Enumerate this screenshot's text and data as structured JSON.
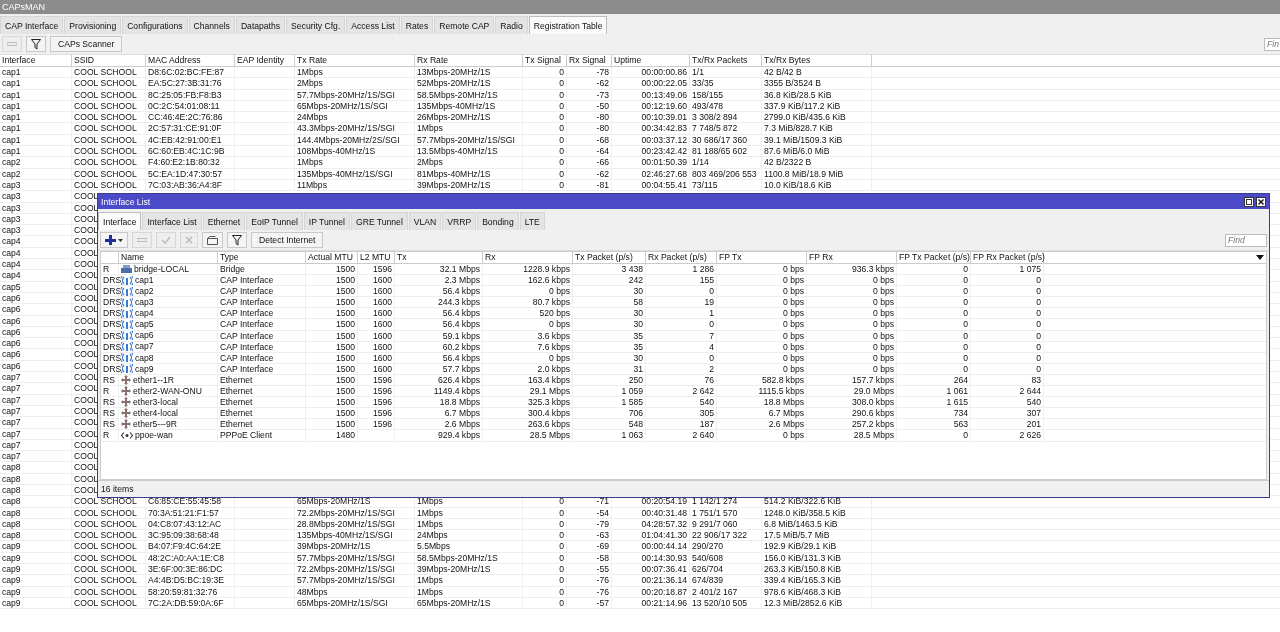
{
  "window": {
    "title": "CAPsMAN"
  },
  "tabs": [
    {
      "label": "CAP Interface",
      "selected": false
    },
    {
      "label": "Provisioning",
      "selected": false
    },
    {
      "label": "Configurations",
      "selected": false
    },
    {
      "label": "Channels",
      "selected": false
    },
    {
      "label": "Datapaths",
      "selected": false
    },
    {
      "label": "Security Cfg.",
      "selected": false
    },
    {
      "label": "Access List",
      "selected": false
    },
    {
      "label": "Rates",
      "selected": false
    },
    {
      "label": "Remote CAP",
      "selected": false
    },
    {
      "label": "Radio",
      "selected": false
    },
    {
      "label": "Registration Table",
      "selected": true
    }
  ],
  "toolbar": {
    "buttons": [
      {
        "kind": "remove",
        "disabled": true
      },
      {
        "kind": "filter",
        "disabled": false
      },
      {
        "kind": "text",
        "label": "CAPs Scanner",
        "disabled": false
      }
    ],
    "find": {
      "placeholder": "Fin"
    }
  },
  "table": {
    "columns": [
      "Interface",
      "SSID",
      "MAC Address",
      "EAP Identity",
      "Tx Rate",
      "Rx Rate",
      "Tx Signal",
      "Rx Signal",
      "Uptime",
      "Tx/Rx Packets",
      "Tx/Rx Bytes"
    ],
    "rows": [
      [
        "cap1",
        "COOL SCHOOL",
        "D8:6C:02:BC:FE:87",
        null,
        "1Mbps",
        "13Mbps-20MHz/1S",
        "0",
        "-78",
        "00:00:00.86",
        "1/1",
        "42 B/42 B"
      ],
      [
        "cap1",
        "COOL SCHOOL",
        "EA:5C:27:3B:31:76",
        null,
        "2Mbps",
        "52Mbps-20MHz/1S",
        "0",
        "-62",
        "00:00:22.05",
        "33/35",
        "3355 B/3524 B"
      ],
      [
        "cap1",
        "COOL SCHOOL",
        "8C:25:05:FB:F8:B3",
        null,
        "57.7Mbps-20MHz/1S/SGI",
        "58.5Mbps-20MHz/1S",
        "0",
        "-73",
        "00:13:49.06",
        "158/155",
        "36.8 KiB/28.5 KiB"
      ],
      [
        "cap1",
        "COOL SCHOOL",
        "0C:2C:54:01:08:11",
        null,
        "65Mbps-20MHz/1S/SGI",
        "135Mbps-40MHz/1S",
        "0",
        "-50",
        "00:12:19.60",
        "493/478",
        "337.9 KiB/117.2 KiB"
      ],
      [
        "cap1",
        "COOL SCHOOL",
        "CC:46:4E:2C:76:86",
        null,
        "24Mbps",
        "26Mbps-20MHz/1S",
        "0",
        "-80",
        "00:10:39.01",
        "3 308/2 894",
        "2799.0 KiB/435.6 KiB"
      ],
      [
        "cap1",
        "COOL SCHOOL",
        "2C:57:31:CE:91:0F",
        null,
        "43.3Mbps-20MHz/1S/SGI",
        "1Mbps",
        "0",
        "-80",
        "00:34:42.83",
        "7 748/5 872",
        "7.3 MiB/828.7 KiB"
      ],
      [
        "cap1",
        "COOL SCHOOL",
        "4C:EB:42:91:00:E1",
        null,
        "144.4Mbps-20MHz/2S/SGI",
        "57.7Mbps-20MHz/1S/SGI",
        "0",
        "-68",
        "00:03:37.12",
        "30 686/17 360",
        "39.1 MiB/1509.3 KiB"
      ],
      [
        "cap1",
        "COOL SCHOOL",
        "6C:60:EB:4C:1C:9B",
        null,
        "108Mbps-40MHz/1S",
        "13.5Mbps-40MHz/1S",
        "0",
        "-64",
        "00:23:42.42",
        "81 188/65 602",
        "87.6 MiB/6.0 MiB"
      ],
      [
        "cap2",
        "COOL SCHOOL",
        "F4:60:E2:1B:80:32",
        null,
        "1Mbps",
        "2Mbps",
        "0",
        "-66",
        "00:01:50.39",
        "1/14",
        "42 B/2322 B"
      ],
      [
        "cap2",
        "COOL SCHOOL",
        "5C:EA:1D:47:30:57",
        null,
        "135Mbps-40MHz/1S/SGI",
        "81Mbps-40MHz/1S",
        "0",
        "-62",
        "02:46:27.68",
        "803 469/206 553",
        "1100.8 MiB/18.9 MiB"
      ],
      [
        "cap3",
        "COOL SCHOOL",
        "7C:03:AB:36:A4:8F",
        null,
        "11Mbps",
        "39Mbps-20MHz/1S",
        "0",
        "-81",
        "00:04:55.41",
        "73/115",
        "10.0 KiB/18.6 KiB"
      ],
      [
        "cap3",
        "COOL"
      ],
      [
        "cap3",
        "COOL"
      ],
      [
        "cap3",
        "COOL"
      ],
      [
        "cap3",
        "COOL"
      ],
      [
        "cap4",
        "COOL"
      ],
      [
        "cap4",
        "COOL"
      ],
      [
        "cap4",
        "COOL"
      ],
      [
        "cap4",
        "COOL"
      ],
      [
        "cap5",
        "COOL"
      ],
      [
        "cap6",
        "COOL"
      ],
      [
        "cap6",
        "COOL"
      ],
      [
        "cap6",
        "COOL"
      ],
      [
        "cap6",
        "COOL"
      ],
      [
        "cap6",
        "COOL"
      ],
      [
        "cap6",
        "COOL"
      ],
      [
        "cap6",
        "COOL"
      ],
      [
        "cap7",
        "COOL"
      ],
      [
        "cap7",
        "COOL"
      ],
      [
        "cap7",
        "COOL"
      ],
      [
        "cap7",
        "COOL"
      ],
      [
        "cap7",
        "COOL"
      ],
      [
        "cap7",
        "COOL"
      ],
      [
        "cap7",
        "COOL"
      ],
      [
        "cap7",
        "COOL"
      ],
      [
        "cap8",
        "COOL"
      ],
      [
        "cap8",
        "COOL"
      ],
      [
        "cap8",
        "COOL"
      ],
      [
        "cap8",
        "COOL SCHOOL",
        "C6:85:CE:55:45:58",
        null,
        "65Mbps-20MHz/1S",
        "1Mbps",
        "0",
        "-71",
        "00:20:54.19",
        "1 142/1 274",
        "514.2 KiB/322.6 KiB"
      ],
      [
        "cap8",
        "COOL SCHOOL",
        "70:3A:51:21:F1:57",
        null,
        "72.2Mbps-20MHz/1S/SGI",
        "1Mbps",
        "0",
        "-54",
        "00:40:31.48",
        "1 751/1 570",
        "1248.0 KiB/358.5 KiB"
      ],
      [
        "cap8",
        "COOL SCHOOL",
        "04:C8:07:43:12:AC",
        null,
        "28.8Mbps-20MHz/1S/SGI",
        "1Mbps",
        "0",
        "-79",
        "04:28:57.32",
        "9 291/7 060",
        "6.8 MiB/1463.5 KiB"
      ],
      [
        "cap8",
        "COOL SCHOOL",
        "3C:95:09:38:68:48",
        null,
        "135Mbps-40MHz/1S/SGI",
        "24Mbps",
        "0",
        "-63",
        "01:04:41.30",
        "22 906/17 322",
        "17.5 MiB/5.7 MiB"
      ],
      [
        "cap9",
        "COOL SCHOOL",
        "B4:07:F9:4C:64:2E",
        null,
        "39Mbps-20MHz/1S",
        "5.5Mbps",
        "0",
        "-69",
        "00:00:44.14",
        "290/270",
        "192.9 KiB/29.1 KiB"
      ],
      [
        "cap9",
        "COOL SCHOOL",
        "48:2C:A0:AA:1E:C8",
        null,
        "57.7Mbps-20MHz/1S/SGI",
        "58.5Mbps-20MHz/1S",
        "0",
        "-58",
        "00:14:30.93",
        "540/608",
        "156.0 KiB/131.3 KiB"
      ],
      [
        "cap9",
        "COOL SCHOOL",
        "3E:6F:00:3E:86:DC",
        null,
        "72.2Mbps-20MHz/1S/SGI",
        "39Mbps-20MHz/1S",
        "0",
        "-55",
        "00:07:36.41",
        "626/704",
        "263.3 KiB/150.8 KiB"
      ],
      [
        "cap9",
        "COOL SCHOOL",
        "A4:4B:D5:BC:19:3E",
        null,
        "57.7Mbps-20MHz/1S/SGI",
        "1Mbps",
        "0",
        "-76",
        "00:21:36.14",
        "674/839",
        "339.4 KiB/165.3 KiB"
      ],
      [
        "cap9",
        "COOL SCHOOL",
        "58:20:59:81:32:76",
        null,
        "48Mbps",
        "1Mbps",
        "0",
        "-76",
        "00:20:18.87",
        "2 401/2 167",
        "978.6 KiB/468.3 KiB"
      ],
      [
        "cap9",
        "COOL SCHOOL",
        "7C:2A:DB:59:0A:6F",
        null,
        "65Mbps-20MHz/1S/SGI",
        "65Mbps-20MHz/1S",
        "0",
        "-57",
        "00:21:14.96",
        "13 520/10 505",
        "12.3 MiB/2852.6 KiB"
      ]
    ]
  },
  "interface_list": {
    "title": "Interface List",
    "tabs": [
      {
        "label": "Interface",
        "selected": true
      },
      {
        "label": "Interface List",
        "selected": false
      },
      {
        "label": "Ethernet",
        "selected": false
      },
      {
        "label": "EoIP Tunnel",
        "selected": false
      },
      {
        "label": "IP Tunnel",
        "selected": false
      },
      {
        "label": "GRE Tunnel",
        "selected": false
      },
      {
        "label": "VLAN",
        "selected": false
      },
      {
        "label": "VRRP",
        "selected": false
      },
      {
        "label": "Bonding",
        "selected": false
      },
      {
        "label": "LTE",
        "selected": false
      }
    ],
    "toolbar": [
      {
        "kind": "add",
        "disabled": false
      },
      {
        "kind": "remove",
        "disabled": true
      },
      {
        "kind": "enable",
        "disabled": true
      },
      {
        "kind": "disable",
        "disabled": true
      },
      {
        "kind": "comment",
        "disabled": false
      },
      {
        "kind": "filter",
        "disabled": false
      },
      {
        "kind": "text",
        "label": "Detect Internet",
        "disabled": false
      }
    ],
    "find": {
      "placeholder": "Find"
    },
    "columns": [
      "Name",
      "Type",
      "Actual MTU",
      "L2 MTU",
      "Tx",
      "Rx",
      "Tx Packet (p/s)",
      "Rx Packet (p/s)",
      "FP Tx",
      "FP Rx",
      "FP Tx Packet (p/s)",
      "FP Rx Packet (p/s)"
    ],
    "rows": [
      {
        "kind": "bridge",
        "flags": "R",
        "cells": [
          "bridge-LOCAL",
          "Bridge",
          "1500",
          "1596",
          "32.1 Mbps",
          "1228.9 kbps",
          "3 438",
          "1 286",
          "0 bps",
          "936.3 kbps",
          "0",
          "1 075"
        ]
      },
      {
        "kind": "cap",
        "flags": "DRS",
        "cells": [
          "cap1",
          "CAP Interface",
          "1500",
          "1600",
          "2.3 Mbps",
          "162.6 kbps",
          "242",
          "155",
          "0 bps",
          "0 bps",
          "0",
          "0"
        ]
      },
      {
        "kind": "cap",
        "flags": "DRS",
        "cells": [
          "cap2",
          "CAP Interface",
          "1500",
          "1600",
          "56.4 kbps",
          "0 bps",
          "30",
          "0",
          "0 bps",
          "0 bps",
          "0",
          "0"
        ]
      },
      {
        "kind": "cap",
        "flags": "DRS",
        "cells": [
          "cap3",
          "CAP Interface",
          "1500",
          "1600",
          "244.3 kbps",
          "80.7 kbps",
          "58",
          "19",
          "0 bps",
          "0 bps",
          "0",
          "0"
        ]
      },
      {
        "kind": "cap",
        "flags": "DRS",
        "cells": [
          "cap4",
          "CAP Interface",
          "1500",
          "1600",
          "56.4 kbps",
          "520 bps",
          "30",
          "1",
          "0 bps",
          "0 bps",
          "0",
          "0"
        ]
      },
      {
        "kind": "cap",
        "flags": "DRS",
        "cells": [
          "cap5",
          "CAP Interface",
          "1500",
          "1600",
          "56.4 kbps",
          "0 bps",
          "30",
          "0",
          "0 bps",
          "0 bps",
          "0",
          "0"
        ]
      },
      {
        "kind": "cap",
        "flags": "DRS",
        "cells": [
          "cap6",
          "CAP Interface",
          "1500",
          "1600",
          "59.1 kbps",
          "3.6 kbps",
          "35",
          "7",
          "0 bps",
          "0 bps",
          "0",
          "0"
        ]
      },
      {
        "kind": "cap",
        "flags": "DRS",
        "cells": [
          "cap7",
          "CAP Interface",
          "1500",
          "1600",
          "60.2 kbps",
          "7.6 kbps",
          "35",
          "4",
          "0 bps",
          "0 bps",
          "0",
          "0"
        ]
      },
      {
        "kind": "cap",
        "flags": "DRS",
        "cells": [
          "cap8",
          "CAP Interface",
          "1500",
          "1600",
          "56.4 kbps",
          "0 bps",
          "30",
          "0",
          "0 bps",
          "0 bps",
          "0",
          "0"
        ]
      },
      {
        "kind": "cap",
        "flags": "DRS",
        "cells": [
          "cap9",
          "CAP Interface",
          "1500",
          "1600",
          "57.7 kbps",
          "2.0 kbps",
          "31",
          "2",
          "0 bps",
          "0 bps",
          "0",
          "0"
        ]
      },
      {
        "kind": "ethernet",
        "flags": "RS",
        "cells": [
          "ether1--1R",
          "Ethernet",
          "1500",
          "1596",
          "626.4 kbps",
          "163.4 kbps",
          "250",
          "76",
          "582.8 kbps",
          "157.7 kbps",
          "264",
          "83"
        ]
      },
      {
        "kind": "ethernet",
        "flags": "R",
        "cells": [
          "ether2-WAN-ONU",
          "Ethernet",
          "1500",
          "1596",
          "1149.4 kbps",
          "29.1 Mbps",
          "1 059",
          "2 642",
          "1115.5 kbps",
          "29.0 Mbps",
          "1 061",
          "2 644"
        ]
      },
      {
        "kind": "ethernet",
        "flags": "RS",
        "cells": [
          "ether3-local",
          "Ethernet",
          "1500",
          "1596",
          "18.8 Mbps",
          "325.3 kbps",
          "1 585",
          "540",
          "18.8 Mbps",
          "308.0 kbps",
          "1 615",
          "540"
        ]
      },
      {
        "kind": "ethernet",
        "flags": "RS",
        "cells": [
          "ether4-local",
          "Ethernet",
          "1500",
          "1596",
          "6.7 Mbps",
          "300.4 kbps",
          "706",
          "305",
          "6.7 Mbps",
          "290.6 kbps",
          "734",
          "307"
        ]
      },
      {
        "kind": "ethernet",
        "flags": "RS",
        "cells": [
          "ether5---9R",
          "Ethernet",
          "1500",
          "1596",
          "2.6 Mbps",
          "263.6 kbps",
          "548",
          "187",
          "2.6 Mbps",
          "257.2 kbps",
          "563",
          "201"
        ]
      },
      {
        "kind": "pppoe",
        "flags": "R",
        "cells": [
          "ppoe-wan",
          "PPPoE Client",
          "1480",
          null,
          "929.4 kbps",
          "28.5 Mbps",
          "1 063",
          "2 640",
          "0 bps",
          "28.5 Mbps",
          "0",
          "2 626"
        ]
      }
    ],
    "status": "16 items"
  }
}
